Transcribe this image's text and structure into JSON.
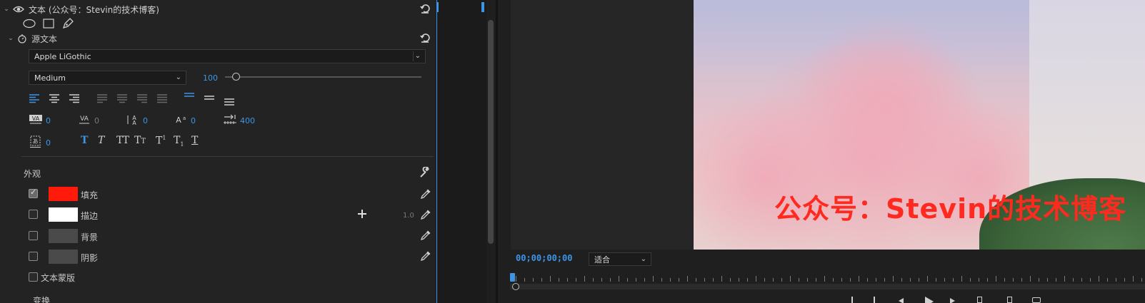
{
  "effect_controls": {
    "text_layer_title": "文本 (公众号：Stevin的技术博客)",
    "source_text_label": "源文本",
    "font_family": "Apple LiGothic",
    "font_style": "Medium",
    "font_size": "100",
    "metrics": {
      "kerning": "0",
      "tracking": "0",
      "leading": "0",
      "baseline_shift": "0",
      "tab_width": "400",
      "tsume": "0"
    },
    "appearance_label": "外观",
    "appearance_items": [
      {
        "label": "填充",
        "checked": true,
        "color": "#ff1a0a"
      },
      {
        "label": "描边",
        "checked": false,
        "color": "#ffffff",
        "value": "1.0"
      },
      {
        "label": "背景",
        "checked": false,
        "color": "#4a4a4a"
      },
      {
        "label": "阴影",
        "checked": false,
        "color": "#4a4a4a"
      }
    ],
    "text_mask_label": "文本蒙版",
    "transform_label": "变换"
  },
  "program_monitor": {
    "timecode": "00;00;00;00",
    "zoom_option": "适合",
    "overlay_text": "公众号：Stevin的技术博客",
    "overlay_color": "#ff2a1f"
  },
  "colors": {
    "accent": "#3d95e8",
    "panel_bg": "#232323"
  }
}
